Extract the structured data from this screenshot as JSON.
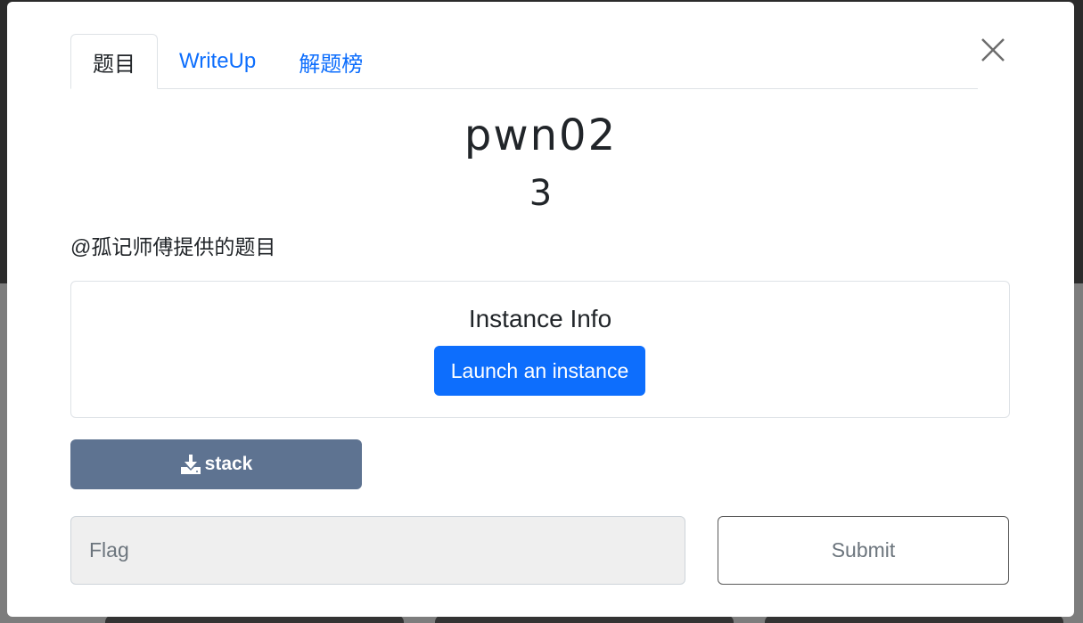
{
  "tabs": [
    {
      "label": "题目",
      "active": true
    },
    {
      "label": "WriteUp",
      "active": false
    },
    {
      "label": "解题榜",
      "active": false
    }
  ],
  "challenge": {
    "name": "pwn02",
    "points": "3",
    "description": "@孤记师傅提供的题目"
  },
  "instance": {
    "title": "Instance Info",
    "launch_label": "Launch an instance"
  },
  "download": {
    "label": "stack",
    "icon": "download-icon"
  },
  "flag_form": {
    "placeholder": "Flag",
    "value": "",
    "submit_label": "Submit"
  },
  "colors": {
    "primary": "#0d6efd",
    "download_bg": "#5e7391",
    "flag_bg": "#efefef"
  }
}
